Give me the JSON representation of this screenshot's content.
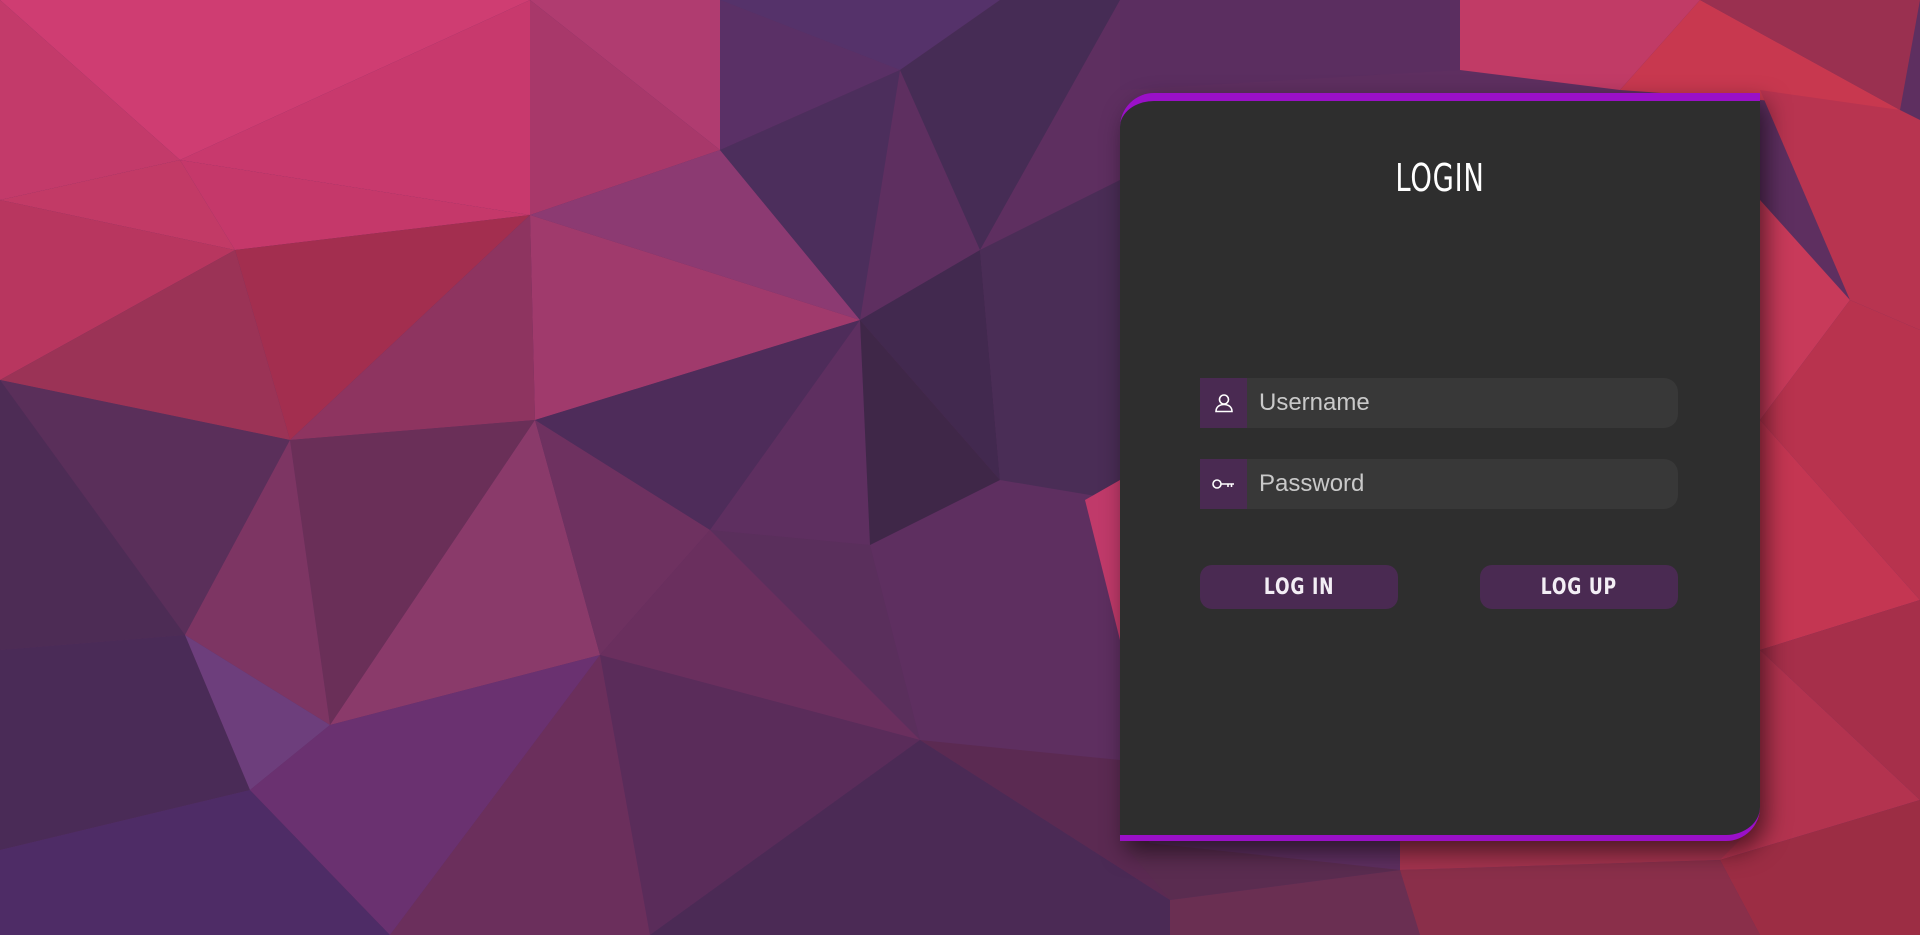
{
  "login": {
    "title": "LOGIN",
    "username": {
      "placeholder": "Username",
      "value": "",
      "icon": "user-icon"
    },
    "password": {
      "placeholder": "Password",
      "value": "",
      "icon": "key-icon"
    },
    "login_button": "LOG IN",
    "logup_button": "LOG UP"
  },
  "colors": {
    "card_bg": "#2e2e2e",
    "accent": "#9a10c8",
    "field_bg": "#383838",
    "icon_bg": "#4a2a52",
    "button_bg": "#4a2a52",
    "title_text": "#ffffff"
  }
}
